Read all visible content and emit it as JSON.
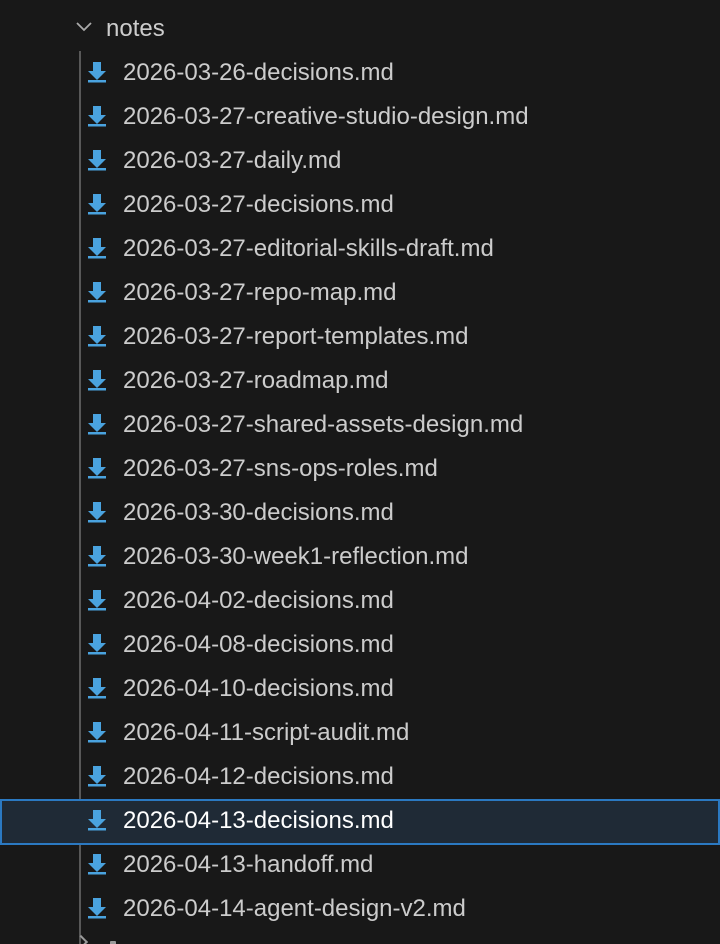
{
  "explorer": {
    "folder": {
      "name": "notes",
      "expanded": true,
      "chevron_icon": "chevron-down-icon"
    },
    "file_icon": "download-arrow-icon",
    "icon_color": "#4aa3df",
    "selected_index": 17,
    "files": [
      {
        "label": "2026-03-26-decisions.md"
      },
      {
        "label": "2026-03-27-creative-studio-design.md"
      },
      {
        "label": "2026-03-27-daily.md"
      },
      {
        "label": "2026-03-27-decisions.md"
      },
      {
        "label": "2026-03-27-editorial-skills-draft.md"
      },
      {
        "label": "2026-03-27-repo-map.md"
      },
      {
        "label": "2026-03-27-report-templates.md"
      },
      {
        "label": "2026-03-27-roadmap.md"
      },
      {
        "label": "2026-03-27-shared-assets-design.md"
      },
      {
        "label": "2026-03-27-sns-ops-roles.md"
      },
      {
        "label": "2026-03-30-decisions.md"
      },
      {
        "label": "2026-03-30-week1-reflection.md"
      },
      {
        "label": "2026-04-02-decisions.md"
      },
      {
        "label": "2026-04-08-decisions.md"
      },
      {
        "label": "2026-04-10-decisions.md"
      },
      {
        "label": "2026-04-11-script-audit.md"
      },
      {
        "label": "2026-04-12-decisions.md"
      },
      {
        "label": "2026-04-13-decisions.md"
      },
      {
        "label": "2026-04-13-handoff.md"
      },
      {
        "label": "2026-04-14-agent-design-v2.md"
      }
    ]
  }
}
